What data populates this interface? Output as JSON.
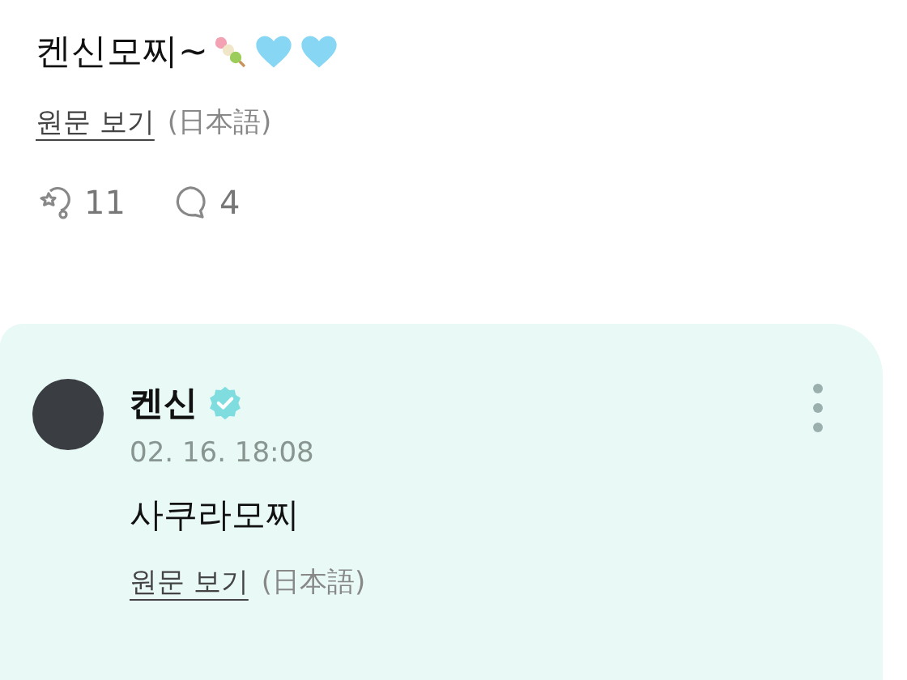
{
  "post": {
    "text": "켄신모찌~",
    "translation_link": "원문 보기",
    "language": "(日本語)",
    "likes": "11",
    "comments": "4"
  },
  "comment": {
    "author": "켄신",
    "verified": true,
    "date": "02. 16. 18:08",
    "text": "사쿠라모찌",
    "translation_link": "원문 보기",
    "language": "(日本語)"
  }
}
